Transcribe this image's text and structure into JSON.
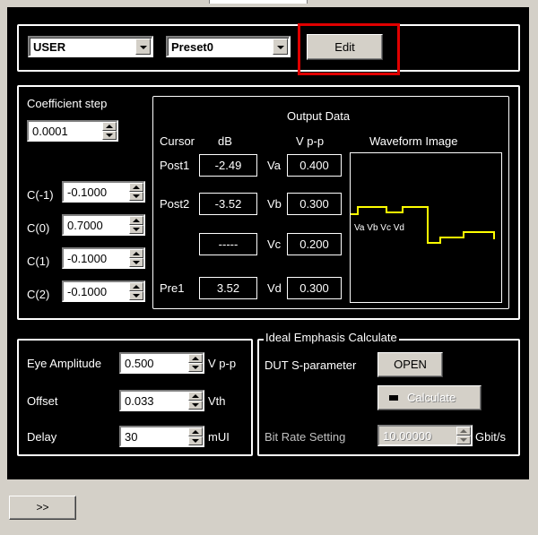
{
  "mode_select": {
    "value": "USER"
  },
  "preset_select": {
    "value": "Preset0"
  },
  "edit_button": {
    "label": "Edit"
  },
  "coefficient": {
    "step_label": "Coefficient step",
    "step_value": "0.0001",
    "rows": [
      {
        "label": "C(-1)",
        "value": "-0.1000"
      },
      {
        "label": "C(0)",
        "value": "0.7000"
      },
      {
        "label": "C(1)",
        "value": "-0.1000"
      },
      {
        "label": "C(2)",
        "value": "-0.1000"
      }
    ]
  },
  "output": {
    "title": "Output Data",
    "col_cursor": "Cursor",
    "col_db": "dB",
    "col_vpp": "V p-p",
    "col_waveform": "Waveform Image",
    "rows": [
      {
        "cursor": "Post1",
        "db": "-2.49",
        "vlabel": "Va",
        "vpp": "0.400"
      },
      {
        "cursor": "Post2",
        "db": "-3.52",
        "vlabel": "Vb",
        "vpp": "0.300"
      },
      {
        "cursor": "",
        "db": "-----",
        "vlabel": "Vc",
        "vpp": "0.200"
      },
      {
        "cursor": "Pre1",
        "db": "3.52",
        "vlabel": "Vd",
        "vpp": "0.300"
      }
    ],
    "waveform_labels": "Va Vb Vc Vd",
    "waveform_color": "#ffff00"
  },
  "eye": {
    "amplitude_label": "Eye Amplitude",
    "amplitude_value": "0.500",
    "amplitude_unit": "V p-p",
    "offset_label": "Offset",
    "offset_value": "0.033",
    "offset_unit": "Vth",
    "delay_label": "Delay",
    "delay_value": "30",
    "delay_unit": "mUI"
  },
  "ideal": {
    "title": "Ideal Emphasis Calculate",
    "dut_label": "DUT S-parameter",
    "open_label": "OPEN",
    "calculate_label": "Calculate",
    "bitrate_label": "Bit Rate Setting",
    "bitrate_value": "10.00000",
    "bitrate_unit": "Gbit/s"
  },
  "expand_button": {
    "label": ">>"
  },
  "colors": {
    "highlight": "#e00000",
    "panel": "#000000",
    "chrome": "#d4d0c8"
  }
}
